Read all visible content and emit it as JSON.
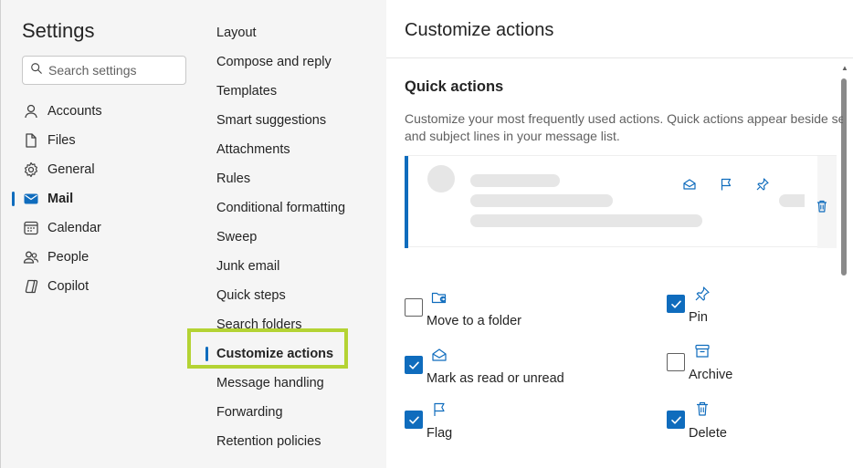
{
  "left_nav": {
    "title": "Settings",
    "search_placeholder": "Search settings",
    "items": [
      {
        "label": "Accounts",
        "icon": "person-icon"
      },
      {
        "label": "Files",
        "icon": "file-icon"
      },
      {
        "label": "General",
        "icon": "gear-icon"
      },
      {
        "label": "Mail",
        "icon": "mail-icon",
        "active": true
      },
      {
        "label": "Calendar",
        "icon": "calendar-icon"
      },
      {
        "label": "People",
        "icon": "people-icon"
      },
      {
        "label": "Copilot",
        "icon": "copilot-icon"
      }
    ]
  },
  "sub_nav": {
    "items": [
      "Layout",
      "Compose and reply",
      "Templates",
      "Smart suggestions",
      "Attachments",
      "Rules",
      "Conditional formatting",
      "Sweep",
      "Junk email",
      "Quick steps",
      "Search folders",
      "Customize actions",
      "Message handling",
      "Forwarding",
      "Retention policies"
    ],
    "active": "Customize actions"
  },
  "content": {
    "header": "Customize actions",
    "section_title": "Quick actions",
    "section_desc_line1": "Customize your most frequently used actions. Quick actions appear beside se",
    "section_desc_line2": "and subject lines in your message list.",
    "options": {
      "move": {
        "label": "Move to a folder",
        "checked": false,
        "icon": "folder-move-icon"
      },
      "read": {
        "label": "Mark as read or unread",
        "checked": true,
        "icon": "mail-read-icon"
      },
      "flag": {
        "label": "Flag",
        "checked": true,
        "icon": "flag-icon"
      },
      "pin": {
        "label": "Pin",
        "checked": true,
        "icon": "pin-icon"
      },
      "archive": {
        "label": "Archive",
        "checked": false,
        "icon": "archive-icon"
      },
      "delete": {
        "label": "Delete",
        "checked": true,
        "icon": "trash-icon"
      }
    }
  },
  "colors": {
    "accent": "#0f6cbd",
    "highlight": "#b4d334",
    "nav_bg": "#f5f5f5"
  }
}
